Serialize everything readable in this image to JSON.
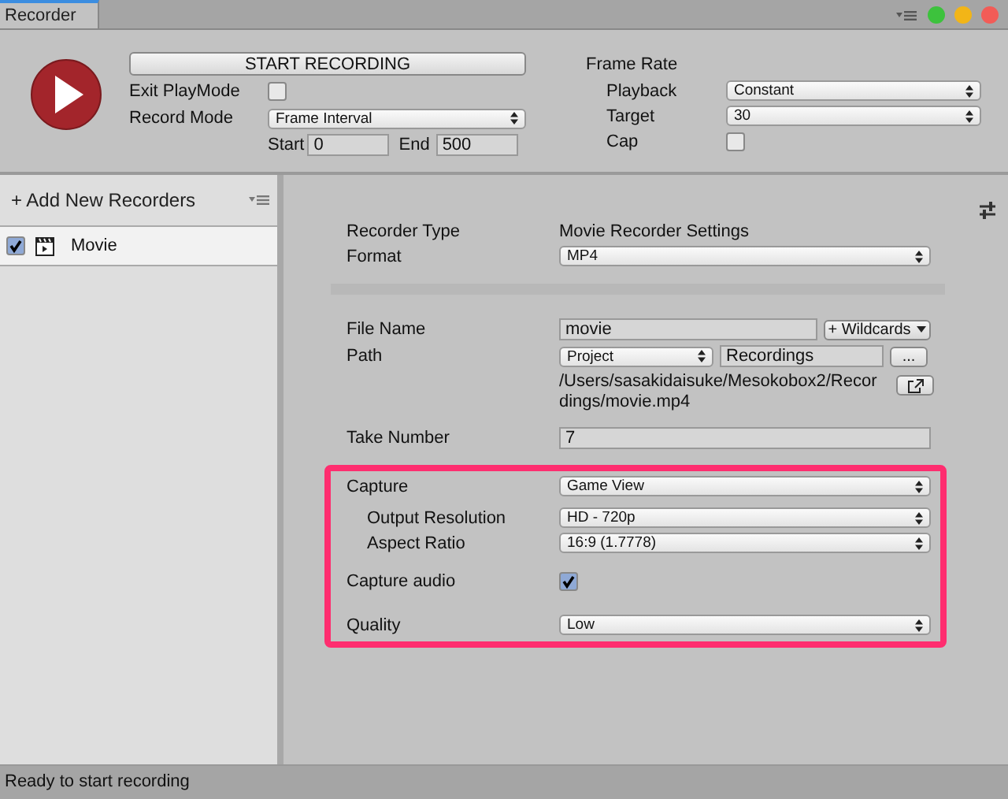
{
  "window": {
    "title": "Recorder"
  },
  "header": {
    "start_button": "START RECORDING",
    "exit_playmode": {
      "label": "Exit PlayMode",
      "checked": false
    },
    "record_mode": {
      "label": "Record Mode",
      "value": "Frame Interval"
    },
    "start": {
      "label": "Start",
      "value": "0"
    },
    "end": {
      "label": "End",
      "value": "500"
    }
  },
  "frame_rate": {
    "title": "Frame Rate",
    "playback": {
      "label": "Playback",
      "value": "Constant"
    },
    "target": {
      "label": "Target",
      "value": "30"
    },
    "cap": {
      "label": "Cap",
      "checked": false
    }
  },
  "sidebar": {
    "add_button": "+ Add New Recorders",
    "items": [
      {
        "label": "Movie",
        "checked": true,
        "selected": true
      }
    ]
  },
  "settings": {
    "recorder_type": {
      "label": "Recorder Type",
      "value": "Movie Recorder Settings"
    },
    "format": {
      "label": "Format",
      "value": "MP4"
    },
    "file_name": {
      "label": "File Name",
      "value": "movie",
      "wildcards": "+ Wildcards"
    },
    "path": {
      "label": "Path",
      "root": "Project",
      "folder": "Recordings",
      "browse": "...",
      "full_path": "/Users/sasakidaisuke/Mesokobox2/Recordings/movie.mp4"
    },
    "take_number": {
      "label": "Take Number",
      "value": "7"
    },
    "capture": {
      "label": "Capture",
      "value": "Game View"
    },
    "output_resolution": {
      "label": "Output Resolution",
      "value": "HD - 720p"
    },
    "aspect_ratio": {
      "label": "Aspect Ratio",
      "value": "16:9 (1.7778)"
    },
    "capture_audio": {
      "label": "Capture audio",
      "checked": true
    },
    "quality": {
      "label": "Quality",
      "value": "Low"
    }
  },
  "status_bar": "Ready to start recording"
}
